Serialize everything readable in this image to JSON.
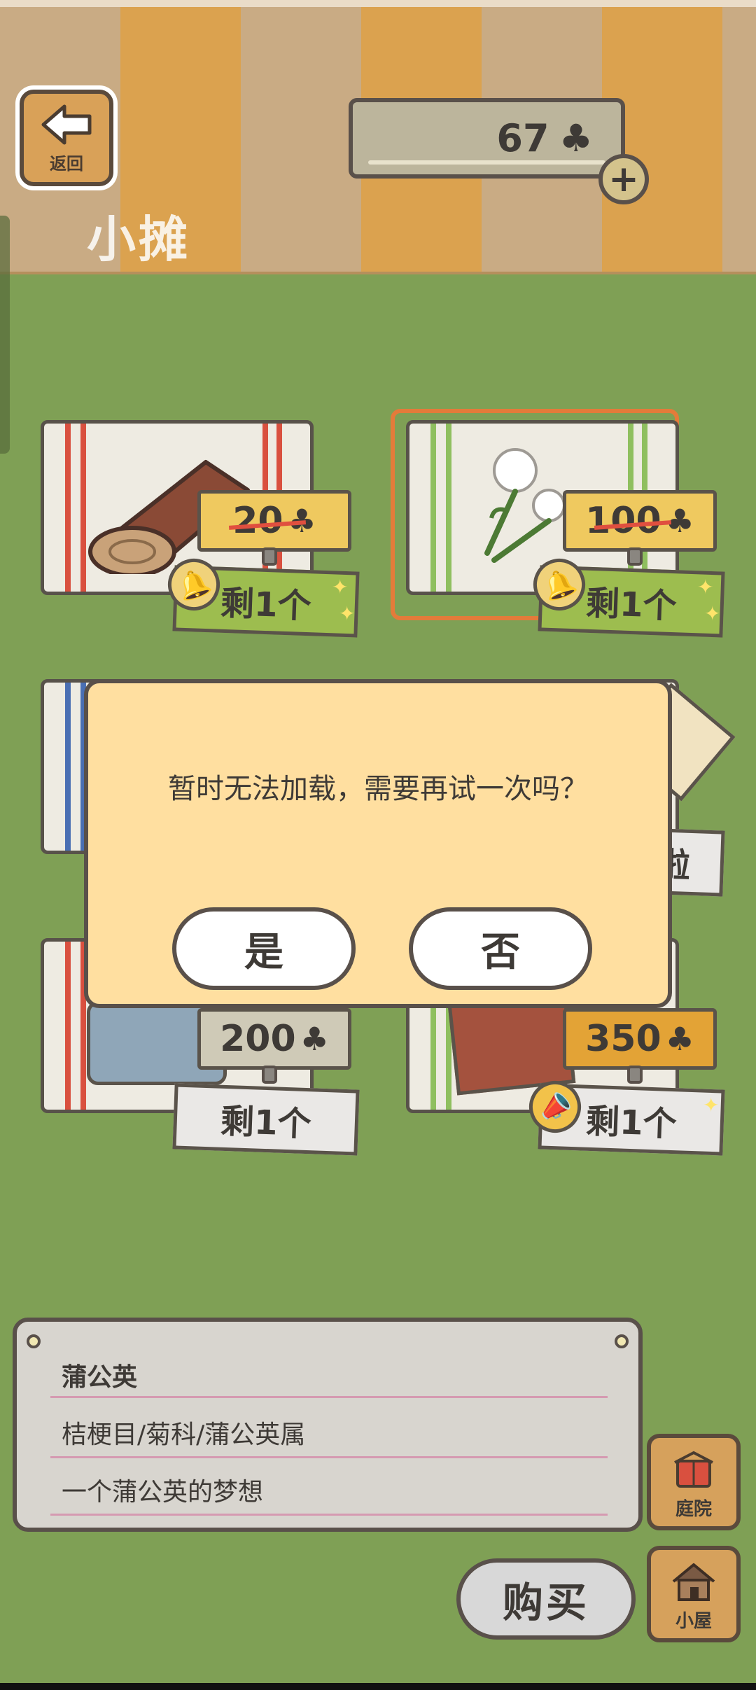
{
  "header": {
    "back_label": "返回",
    "title": "小摊",
    "currency_value": "67",
    "currency_icon": "clover-icon"
  },
  "shop": {
    "items": [
      {
        "name": "log",
        "price": "20",
        "price_strike": true,
        "stock": "剩1个"
      },
      {
        "name": "dandelion",
        "price": "100",
        "price_strike": true,
        "stock": "剩1个"
      },
      {
        "name": "partial",
        "stock_fragment": "啦"
      },
      {
        "name": "blanket",
        "price": "200",
        "stock": "剩1个"
      },
      {
        "name": "wood-box",
        "price": "350",
        "stock": "剩1个"
      }
    ]
  },
  "dialog": {
    "message": "暂时无法加载，需要再试一次吗？",
    "yes": "是",
    "no": "否"
  },
  "info": {
    "name": "蒲公英",
    "category": "桔梗目/菊科/蒲公英属",
    "description": "一个蒲公英的梦想"
  },
  "actions": {
    "buy": "购买",
    "yard": "庭院",
    "house": "小屋"
  },
  "colors": {
    "grass": "#7fa055",
    "dialog_bg": "#ffdfa0",
    "selected_border": "#e47b3a"
  }
}
